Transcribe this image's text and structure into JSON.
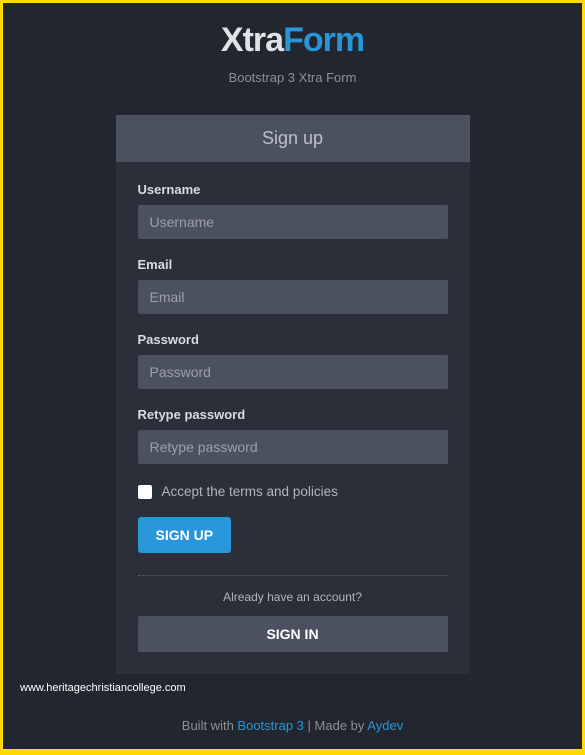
{
  "brand": {
    "first": "Xtra",
    "second": "Form"
  },
  "subtitle": "Bootstrap 3 Xtra Form",
  "form": {
    "header": "Sign up",
    "username": {
      "label": "Username",
      "placeholder": "Username"
    },
    "email": {
      "label": "Email",
      "placeholder": "Email"
    },
    "password": {
      "label": "Password",
      "placeholder": "Password"
    },
    "retype": {
      "label": "Retype password",
      "placeholder": "Retype password"
    },
    "terms_label": "Accept the terms and policies",
    "signup_button": "SIGN UP",
    "already_text": "Already have an account?",
    "signin_button": "SIGN IN"
  },
  "domain": "www.heritagechristiancollege.com",
  "footer": {
    "built_with": "Built with ",
    "bootstrap_link": "Bootstrap 3",
    "separator": " | ",
    "made_by": "Made by ",
    "author_link": "Aydev"
  }
}
